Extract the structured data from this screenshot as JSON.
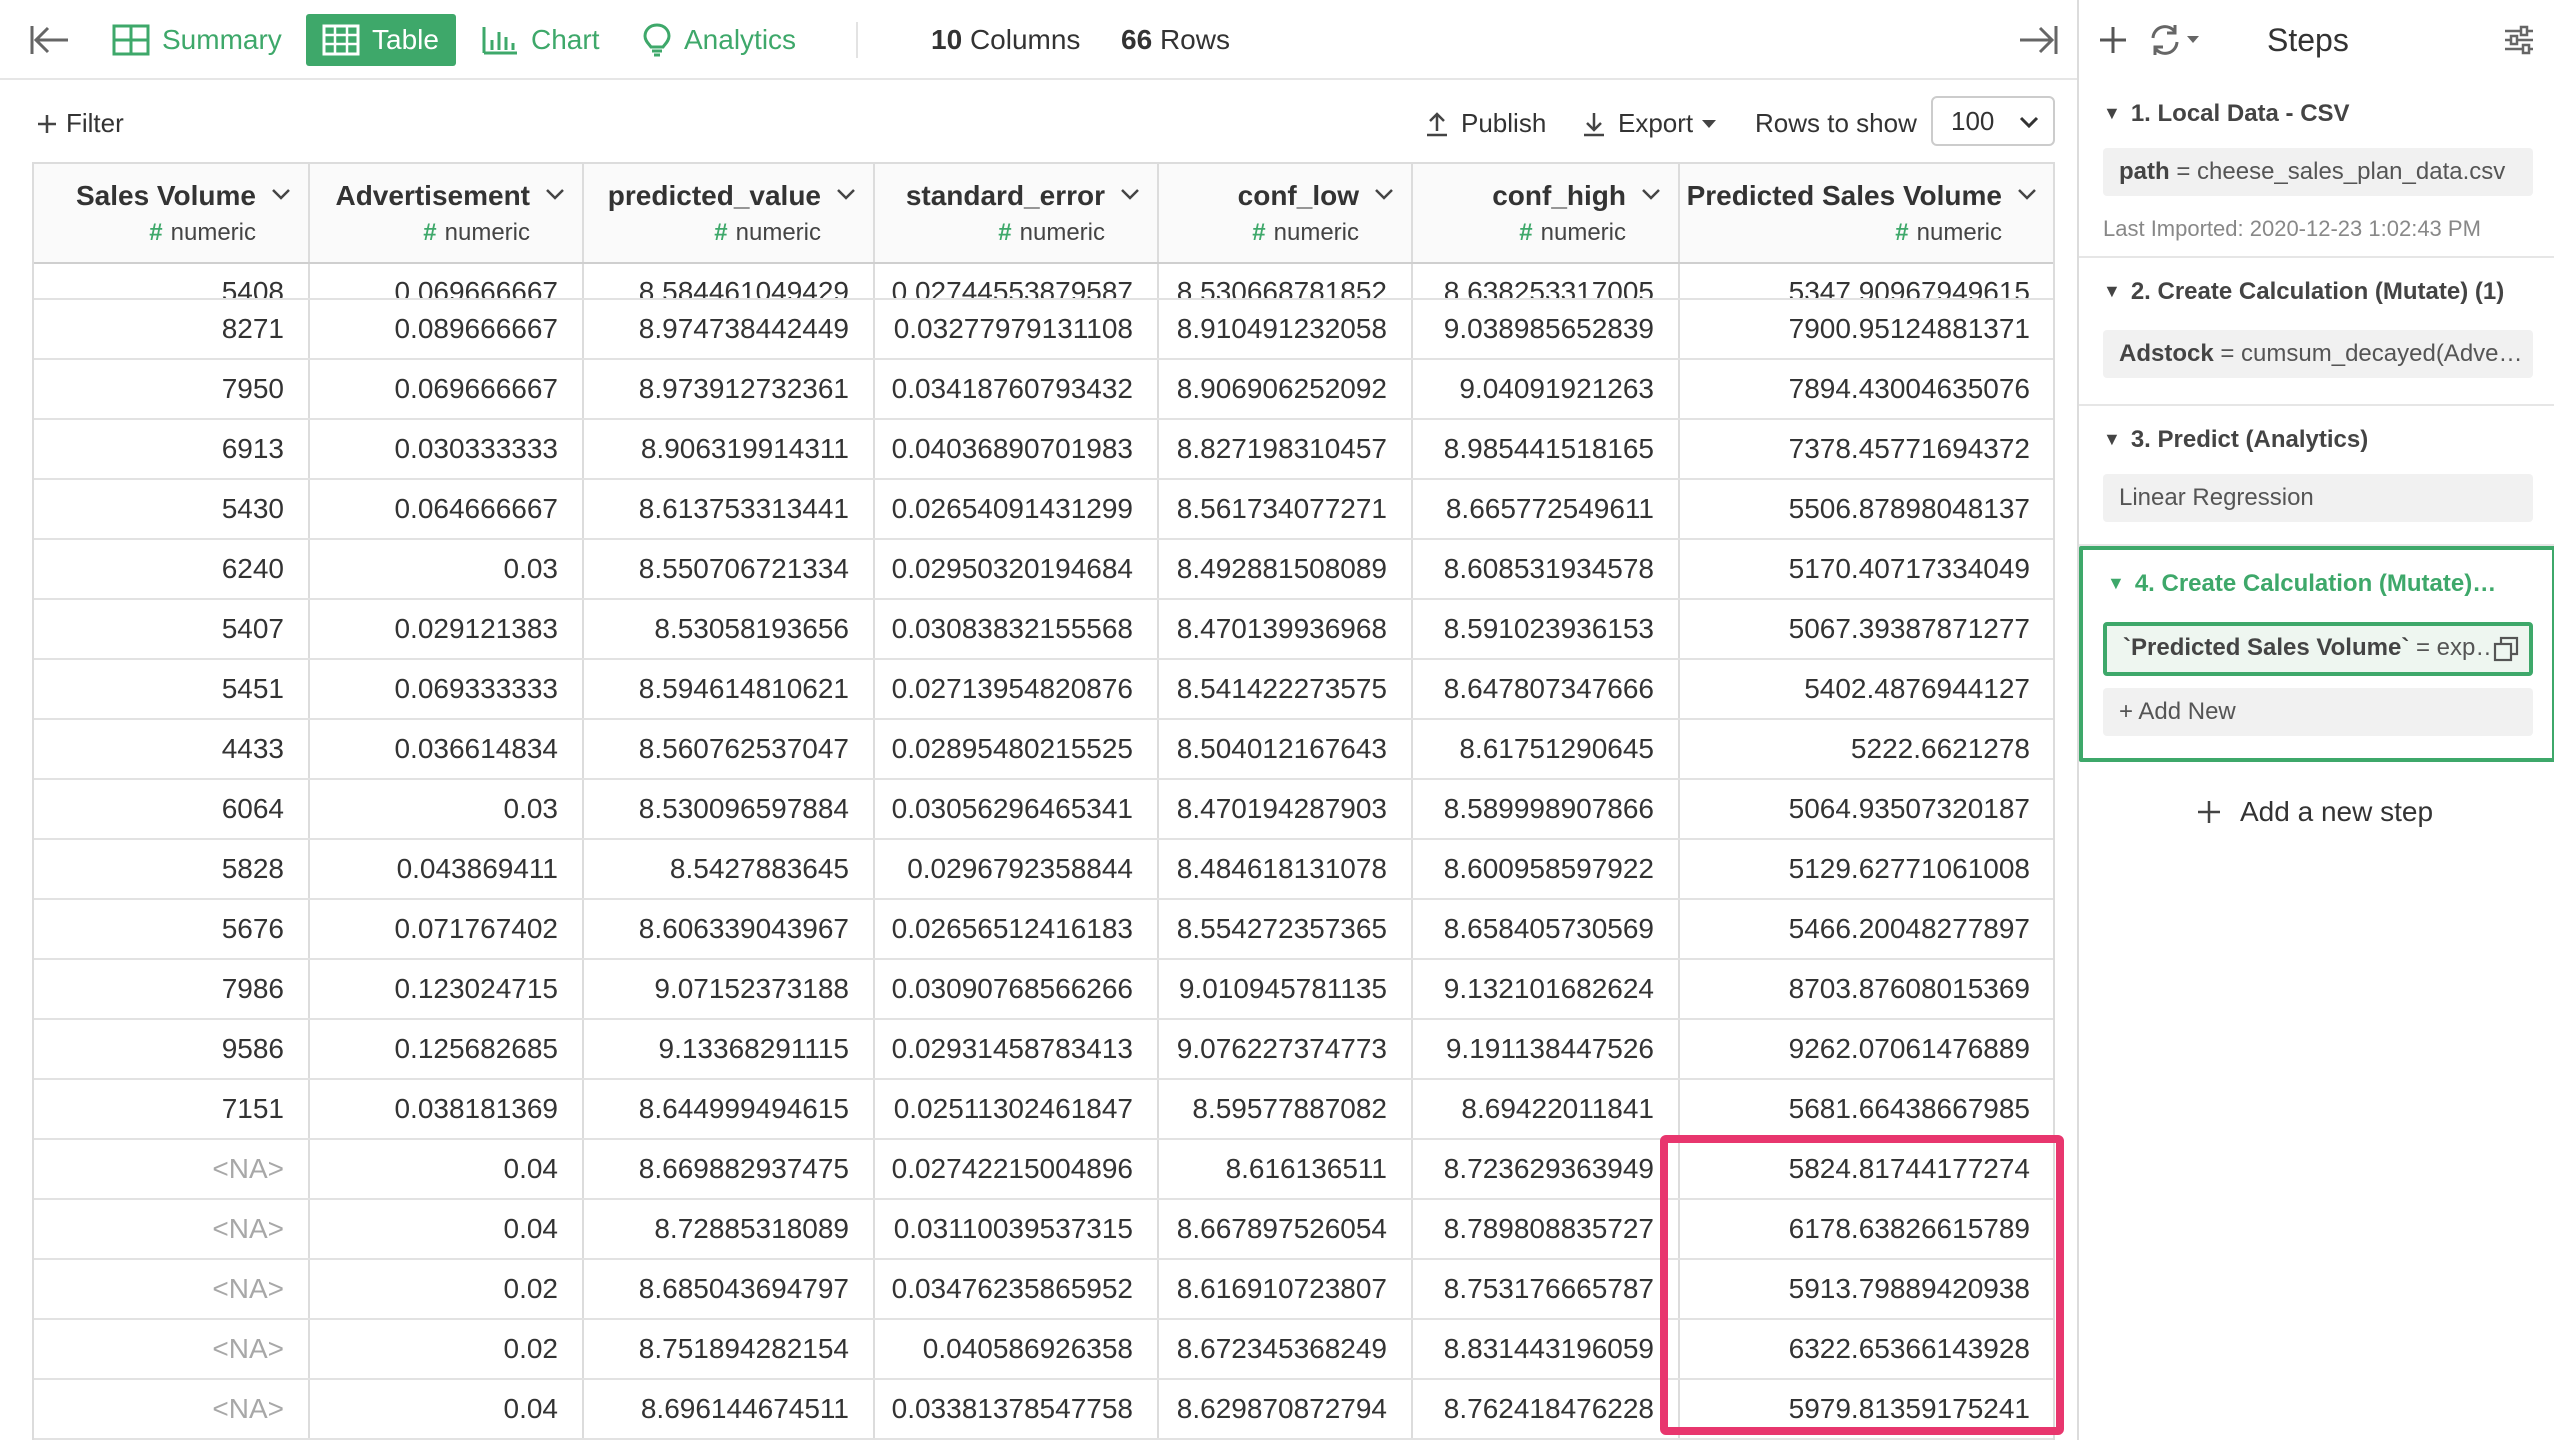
{
  "tabs": [
    {
      "label": "Summary",
      "icon": "summary-grid-icon"
    },
    {
      "label": "Table",
      "icon": "table-icon",
      "active": true
    },
    {
      "label": "Chart",
      "icon": "bar-chart-icon"
    },
    {
      "label": "Analytics",
      "icon": "lightbulb-icon"
    }
  ],
  "counts": {
    "columns_value": "10",
    "columns_label": "Columns",
    "rows_value": "66",
    "rows_label": "Rows"
  },
  "toolbar": {
    "filter_label": "Filter",
    "publish_label": "Publish",
    "export_label": "Export",
    "rows_to_show_label": "Rows to show",
    "rows_to_show_value": "100"
  },
  "table": {
    "columns": [
      {
        "name": "Sales Volume",
        "type": "numeric"
      },
      {
        "name": "Advertisement",
        "type": "numeric"
      },
      {
        "name": "predicted_value",
        "type": "numeric"
      },
      {
        "name": "standard_error",
        "type": "numeric"
      },
      {
        "name": "conf_low",
        "type": "numeric"
      },
      {
        "name": "conf_high",
        "type": "numeric"
      },
      {
        "name": "Predicted Sales Volume",
        "type": "numeric"
      }
    ],
    "partial_row": [
      "5408",
      "0.069666667",
      "8.584461049429",
      "0.02744553879587",
      "8.530668781852",
      "8.638253317005",
      "5347.90967949615"
    ],
    "rows": [
      [
        "8271",
        "0.089666667",
        "8.974738442449",
        "0.03277979131108",
        "8.910491232058",
        "9.038985652839",
        "7900.95124881371"
      ],
      [
        "7950",
        "0.069666667",
        "8.973912732361",
        "0.03418760793432",
        "8.906906252092",
        "9.04091921263",
        "7894.43004635076"
      ],
      [
        "6913",
        "0.030333333",
        "8.906319914311",
        "0.04036890701983",
        "8.827198310457",
        "8.985441518165",
        "7378.45771694372"
      ],
      [
        "5430",
        "0.064666667",
        "8.613753313441",
        "0.02654091431299",
        "8.561734077271",
        "8.665772549611",
        "5506.87898048137"
      ],
      [
        "6240",
        "0.03",
        "8.550706721334",
        "0.02950320194684",
        "8.492881508089",
        "8.608531934578",
        "5170.40717334049"
      ],
      [
        "5407",
        "0.029121383",
        "8.53058193656",
        "0.03083832155568",
        "8.470139936968",
        "8.591023936153",
        "5067.39387871277"
      ],
      [
        "5451",
        "0.069333333",
        "8.594614810621",
        "0.02713954820876",
        "8.541422273575",
        "8.647807347666",
        "5402.4876944127"
      ],
      [
        "4433",
        "0.036614834",
        "8.560762537047",
        "0.02895480215525",
        "8.504012167643",
        "8.61751290645",
        "5222.6621278"
      ],
      [
        "6064",
        "0.03",
        "8.530096597884",
        "0.03056296465341",
        "8.470194287903",
        "8.589998907866",
        "5064.93507320187"
      ],
      [
        "5828",
        "0.043869411",
        "8.5427883645",
        "0.0296792358844",
        "8.484618131078",
        "8.600958597922",
        "5129.62771061008"
      ],
      [
        "5676",
        "0.071767402",
        "8.606339043967",
        "0.02656512416183",
        "8.554272357365",
        "8.658405730569",
        "5466.20048277897"
      ],
      [
        "7986",
        "0.123024715",
        "9.07152373188",
        "0.03090768566266",
        "9.010945781135",
        "9.132101682624",
        "8703.87608015369"
      ],
      [
        "9586",
        "0.125682685",
        "9.13368291115",
        "0.02931458783413",
        "9.076227374773",
        "9.191138447526",
        "9262.07061476889"
      ],
      [
        "7151",
        "0.038181369",
        "8.644999494615",
        "0.02511302461847",
        "8.59577887082",
        "8.69422011841",
        "5681.66438667985"
      ],
      [
        "<NA>",
        "0.04",
        "8.669882937475",
        "0.02742215004896",
        "8.616136511",
        "8.723629363949",
        "5824.81744177274"
      ],
      [
        "<NA>",
        "0.04",
        "8.72885318089",
        "0.03110039537315",
        "8.667897526054",
        "8.789808835727",
        "6178.63826615789"
      ],
      [
        "<NA>",
        "0.02",
        "8.685043694797",
        "0.03476235865952",
        "8.616910723807",
        "8.753176665787",
        "5913.79889420938"
      ],
      [
        "<NA>",
        "0.02",
        "8.751894282154",
        "0.040586926358",
        "8.672345368249",
        "8.831443196059",
        "6322.65366143928"
      ],
      [
        "<NA>",
        "0.04",
        "8.696144674511",
        "0.03381378547758",
        "8.629870872794",
        "8.762418476228",
        "5979.81359175241"
      ]
    ]
  },
  "panel": {
    "title": "Steps",
    "steps": [
      {
        "title": "1. Local Data - CSV",
        "key": "path",
        "expr": "cheese_sales_plan_data.csv",
        "meta": "Last Imported: 2020-12-23 1:02:43 PM"
      },
      {
        "title": "2. Create Calculation (Mutate) (1)",
        "key": "Adstock",
        "expr": "cumsum_decayed(Adve…"
      },
      {
        "title": "3. Predict (Analytics)",
        "value": "Linear Regression"
      },
      {
        "title": "4. Create Calculation (Mutate)…",
        "key": "`Predicted Sales Volume`",
        "expr": "exp…",
        "add_new": "Add New"
      }
    ],
    "add_step_label": "Add a new step"
  },
  "colors": {
    "accent": "#3ea86a",
    "highlight": "#e8366e"
  }
}
